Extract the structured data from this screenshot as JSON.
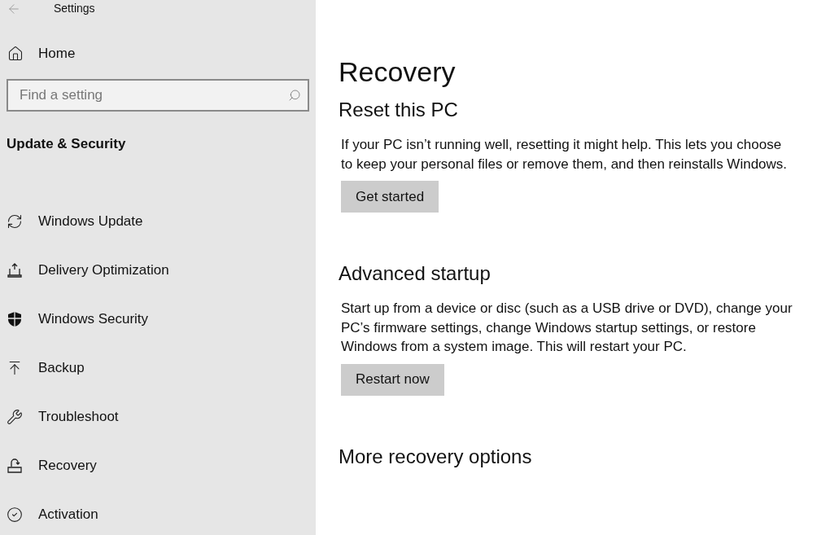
{
  "window": {
    "title": "Settings"
  },
  "sidebar": {
    "home": "Home",
    "search": {
      "placeholder": "Find a setting"
    },
    "section": "Update & Security",
    "items": [
      {
        "label": "Windows Update",
        "selected": false
      },
      {
        "label": "Delivery Optimization",
        "selected": false
      },
      {
        "label": "Windows Security",
        "selected": false
      },
      {
        "label": "Backup",
        "selected": false
      },
      {
        "label": "Troubleshoot",
        "selected": false
      },
      {
        "label": "Recovery",
        "selected": false
      },
      {
        "label": "Activation",
        "selected": false
      }
    ]
  },
  "page": {
    "title": "Recovery",
    "sections": [
      {
        "heading": "Reset this PC",
        "text": "If your PC isn’t running well, resetting it might help. This lets you choose to keep your personal files or remove them, and then reinstalls Windows.",
        "button": "Get started"
      },
      {
        "heading": "Advanced startup",
        "text": "Start up from a device or disc (such as a USB drive or DVD), change your PC’s firmware settings, change Windows startup settings, or restore Windows from a system image. This will restart your PC.",
        "button": "Restart now"
      },
      {
        "heading": "More recovery options"
      }
    ]
  }
}
